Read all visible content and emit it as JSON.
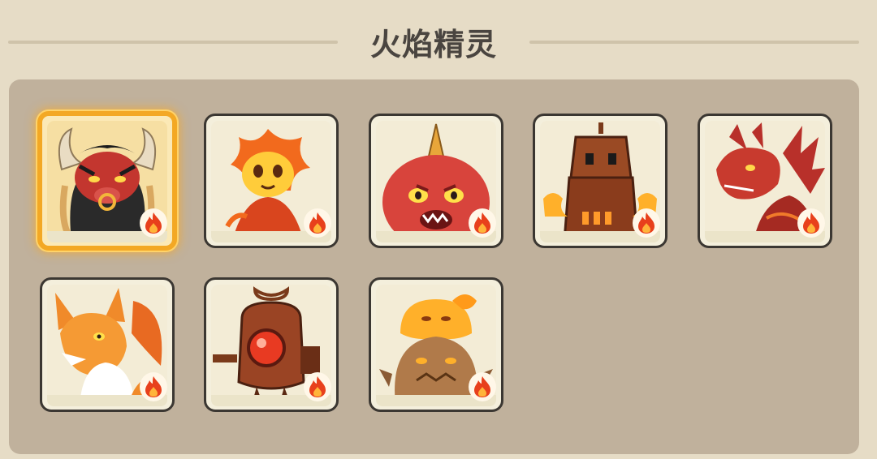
{
  "header": {
    "title": "火焰精灵"
  },
  "colors": {
    "fire": "#e8401c",
    "selected_border": "#f3a824",
    "card_border": "#3b3732",
    "panel": "#c0b19c"
  },
  "cards": [
    {
      "creature": "horned-bull-demon",
      "element_icon": "fire-icon",
      "selected": true
    },
    {
      "creature": "flame-sprite",
      "element_icon": "fire-icon",
      "selected": false
    },
    {
      "creature": "red-horned-blob",
      "element_icon": "fire-icon",
      "selected": false
    },
    {
      "creature": "rusty-furnace-robot",
      "element_icon": "fire-icon",
      "selected": false
    },
    {
      "creature": "red-lava-dragon",
      "element_icon": "fire-icon",
      "selected": false
    },
    {
      "creature": "fire-fox",
      "element_icon": "fire-icon",
      "selected": false
    },
    {
      "creature": "boiler-bomb-robot",
      "element_icon": "fire-icon",
      "selected": false
    },
    {
      "creature": "magma-slime-stack",
      "element_icon": "fire-icon",
      "selected": false
    }
  ]
}
